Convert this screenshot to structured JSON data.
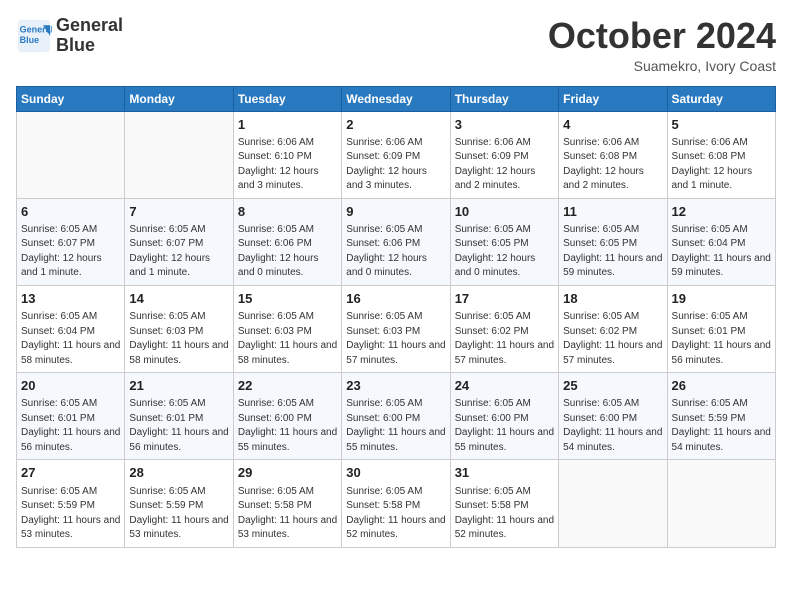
{
  "header": {
    "logo_line1": "General",
    "logo_line2": "Blue",
    "month": "October 2024",
    "location": "Suamekro, Ivory Coast"
  },
  "days_of_week": [
    "Sunday",
    "Monday",
    "Tuesday",
    "Wednesday",
    "Thursday",
    "Friday",
    "Saturday"
  ],
  "weeks": [
    [
      {
        "day": "",
        "info": ""
      },
      {
        "day": "",
        "info": ""
      },
      {
        "day": "1",
        "info": "Sunrise: 6:06 AM\nSunset: 6:10 PM\nDaylight: 12 hours and 3 minutes."
      },
      {
        "day": "2",
        "info": "Sunrise: 6:06 AM\nSunset: 6:09 PM\nDaylight: 12 hours and 3 minutes."
      },
      {
        "day": "3",
        "info": "Sunrise: 6:06 AM\nSunset: 6:09 PM\nDaylight: 12 hours and 2 minutes."
      },
      {
        "day": "4",
        "info": "Sunrise: 6:06 AM\nSunset: 6:08 PM\nDaylight: 12 hours and 2 minutes."
      },
      {
        "day": "5",
        "info": "Sunrise: 6:06 AM\nSunset: 6:08 PM\nDaylight: 12 hours and 1 minute."
      }
    ],
    [
      {
        "day": "6",
        "info": "Sunrise: 6:05 AM\nSunset: 6:07 PM\nDaylight: 12 hours and 1 minute."
      },
      {
        "day": "7",
        "info": "Sunrise: 6:05 AM\nSunset: 6:07 PM\nDaylight: 12 hours and 1 minute."
      },
      {
        "day": "8",
        "info": "Sunrise: 6:05 AM\nSunset: 6:06 PM\nDaylight: 12 hours and 0 minutes."
      },
      {
        "day": "9",
        "info": "Sunrise: 6:05 AM\nSunset: 6:06 PM\nDaylight: 12 hours and 0 minutes."
      },
      {
        "day": "10",
        "info": "Sunrise: 6:05 AM\nSunset: 6:05 PM\nDaylight: 12 hours and 0 minutes."
      },
      {
        "day": "11",
        "info": "Sunrise: 6:05 AM\nSunset: 6:05 PM\nDaylight: 11 hours and 59 minutes."
      },
      {
        "day": "12",
        "info": "Sunrise: 6:05 AM\nSunset: 6:04 PM\nDaylight: 11 hours and 59 minutes."
      }
    ],
    [
      {
        "day": "13",
        "info": "Sunrise: 6:05 AM\nSunset: 6:04 PM\nDaylight: 11 hours and 58 minutes."
      },
      {
        "day": "14",
        "info": "Sunrise: 6:05 AM\nSunset: 6:03 PM\nDaylight: 11 hours and 58 minutes."
      },
      {
        "day": "15",
        "info": "Sunrise: 6:05 AM\nSunset: 6:03 PM\nDaylight: 11 hours and 58 minutes."
      },
      {
        "day": "16",
        "info": "Sunrise: 6:05 AM\nSunset: 6:03 PM\nDaylight: 11 hours and 57 minutes."
      },
      {
        "day": "17",
        "info": "Sunrise: 6:05 AM\nSunset: 6:02 PM\nDaylight: 11 hours and 57 minutes."
      },
      {
        "day": "18",
        "info": "Sunrise: 6:05 AM\nSunset: 6:02 PM\nDaylight: 11 hours and 57 minutes."
      },
      {
        "day": "19",
        "info": "Sunrise: 6:05 AM\nSunset: 6:01 PM\nDaylight: 11 hours and 56 minutes."
      }
    ],
    [
      {
        "day": "20",
        "info": "Sunrise: 6:05 AM\nSunset: 6:01 PM\nDaylight: 11 hours and 56 minutes."
      },
      {
        "day": "21",
        "info": "Sunrise: 6:05 AM\nSunset: 6:01 PM\nDaylight: 11 hours and 56 minutes."
      },
      {
        "day": "22",
        "info": "Sunrise: 6:05 AM\nSunset: 6:00 PM\nDaylight: 11 hours and 55 minutes."
      },
      {
        "day": "23",
        "info": "Sunrise: 6:05 AM\nSunset: 6:00 PM\nDaylight: 11 hours and 55 minutes."
      },
      {
        "day": "24",
        "info": "Sunrise: 6:05 AM\nSunset: 6:00 PM\nDaylight: 11 hours and 55 minutes."
      },
      {
        "day": "25",
        "info": "Sunrise: 6:05 AM\nSunset: 6:00 PM\nDaylight: 11 hours and 54 minutes."
      },
      {
        "day": "26",
        "info": "Sunrise: 6:05 AM\nSunset: 5:59 PM\nDaylight: 11 hours and 54 minutes."
      }
    ],
    [
      {
        "day": "27",
        "info": "Sunrise: 6:05 AM\nSunset: 5:59 PM\nDaylight: 11 hours and 53 minutes."
      },
      {
        "day": "28",
        "info": "Sunrise: 6:05 AM\nSunset: 5:59 PM\nDaylight: 11 hours and 53 minutes."
      },
      {
        "day": "29",
        "info": "Sunrise: 6:05 AM\nSunset: 5:58 PM\nDaylight: 11 hours and 53 minutes."
      },
      {
        "day": "30",
        "info": "Sunrise: 6:05 AM\nSunset: 5:58 PM\nDaylight: 11 hours and 52 minutes."
      },
      {
        "day": "31",
        "info": "Sunrise: 6:05 AM\nSunset: 5:58 PM\nDaylight: 11 hours and 52 minutes."
      },
      {
        "day": "",
        "info": ""
      },
      {
        "day": "",
        "info": ""
      }
    ]
  ]
}
